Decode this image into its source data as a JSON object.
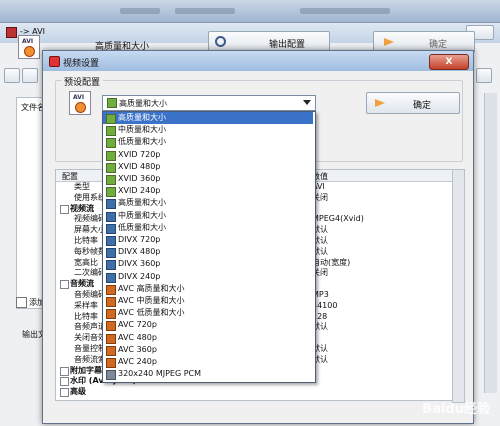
{
  "back_window": {
    "title": "-> AVI",
    "preset_label": "高质量和大小",
    "output_config_label": "输出配置",
    "ok_label": "确定",
    "file_name_header": "文件名",
    "add_checkbox_label": "添加",
    "output_dir_label": "输出文"
  },
  "dialog": {
    "title": "视频设置",
    "close_label": "X",
    "preset_group_label": "预设配置",
    "preset_selected": "高质量和大小",
    "ok_label": "确定",
    "grid_header_config": "配置",
    "grid_header_value": "数值"
  },
  "grid_left_rows": [
    "类型",
    "使用系统解",
    "视频流",
    "视频编码",
    "屏幕大小",
    "比特率",
    "每秒帧数",
    "宽高比",
    "二次编码",
    "音频流",
    "音频编码",
    "采样率",
    "比特率",
    "音频声道",
    "关闭音效",
    "音量控制",
    "音频流索",
    "附加字幕",
    "水印 (AviSynth)",
    "高级"
  ],
  "grid_right_rows": [
    "AVI",
    "关闭",
    "",
    "MPEG4(Xvid)",
    "默认",
    "默认",
    "默认",
    "自动(宽度)",
    "关闭",
    "",
    "MP3",
    "44100",
    "128",
    "默认",
    "",
    "默认",
    "默认",
    "",
    "",
    ""
  ],
  "dropdown_items": [
    {
      "label": "高质量和大小",
      "icon": "xvid-icon"
    },
    {
      "label": "中质量和大小",
      "icon": "xvid-icon"
    },
    {
      "label": "低质量和大小",
      "icon": "xvid-icon"
    },
    {
      "label": "XVID 720p",
      "icon": "xvid-icon"
    },
    {
      "label": "XVID 480p",
      "icon": "xvid-icon"
    },
    {
      "label": "XVID 360p",
      "icon": "xvid-icon"
    },
    {
      "label": "XVID 240p",
      "icon": "xvid-icon"
    },
    {
      "label": "高质量和大小",
      "icon": "divx-icon"
    },
    {
      "label": "中质量和大小",
      "icon": "divx-icon"
    },
    {
      "label": "低质量和大小",
      "icon": "divx-icon"
    },
    {
      "label": "DIVX 720p",
      "icon": "divx-icon"
    },
    {
      "label": "DIVX 480p",
      "icon": "divx-icon"
    },
    {
      "label": "DIVX 360p",
      "icon": "divx-icon"
    },
    {
      "label": "DIVX 240p",
      "icon": "divx-icon"
    },
    {
      "label": "AVC 高质量和大小",
      "icon": "avc-icon"
    },
    {
      "label": "AVC 中质量和大小",
      "icon": "avc-icon"
    },
    {
      "label": "AVC 低质量和大小",
      "icon": "avc-icon"
    },
    {
      "label": "AVC 720p",
      "icon": "avc-icon"
    },
    {
      "label": "AVC 480p",
      "icon": "avc-icon"
    },
    {
      "label": "AVC 360p",
      "icon": "avc-icon"
    },
    {
      "label": "AVC 240p",
      "icon": "avc-icon"
    },
    {
      "label": "320x240 MJPEG PCM",
      "icon": "mjpeg-icon"
    }
  ],
  "watermark": "Baidu经验",
  "colors": {
    "selection": "#3b73c8",
    "title_bar": "#9fbde1"
  }
}
